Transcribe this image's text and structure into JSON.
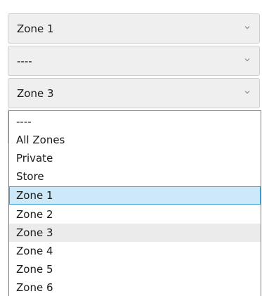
{
  "selects": [
    {
      "value": "Zone 1",
      "icon": "chevron-down-icon"
    },
    {
      "value": "----",
      "icon": "chevron-down-icon"
    },
    {
      "value": "Zone 3",
      "icon": "chevron-down-icon"
    }
  ],
  "dropdown": {
    "options": [
      "----",
      "All Zones",
      "Private",
      "Store",
      "Zone 1",
      "Zone 2",
      "Zone 3",
      "Zone 4",
      "Zone 5",
      "Zone 6"
    ],
    "highlighted": "Zone 1",
    "selected": "Zone 3"
  },
  "colors": {
    "highlight_bg": "#cde8f8",
    "highlight_border": "#3fa0d6",
    "selected_bg": "#ebebeb",
    "select_bg": "#efefef"
  }
}
